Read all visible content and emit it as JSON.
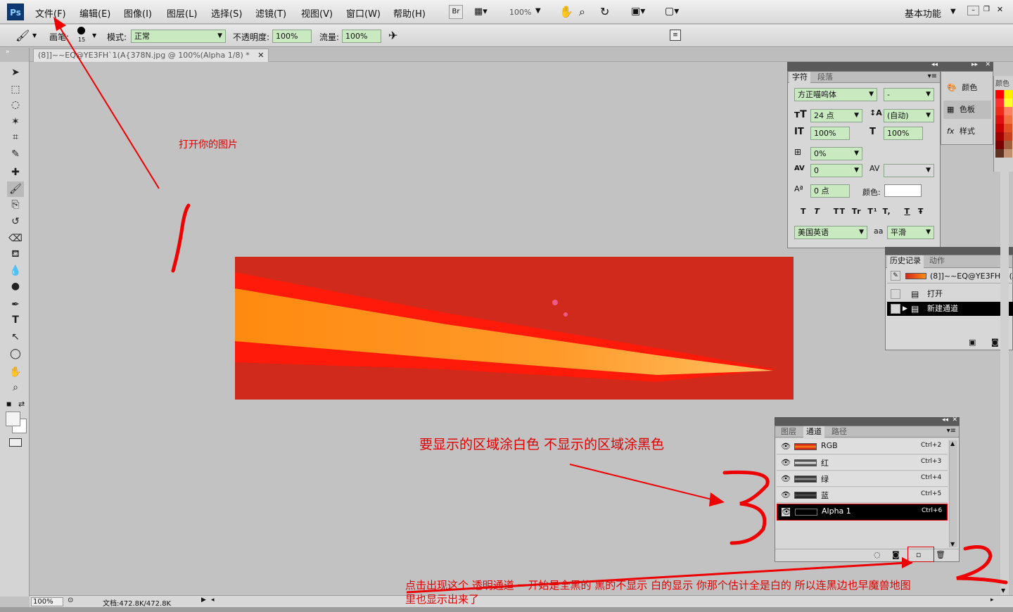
{
  "app": {
    "logo": "Ps",
    "workspace": "基本功能"
  },
  "menu": [
    "文件(F)",
    "编辑(E)",
    "图像(I)",
    "图层(L)",
    "选择(S)",
    "滤镜(T)",
    "视图(V)",
    "窗口(W)",
    "帮助(H)"
  ],
  "appbar": {
    "bridge": "Br",
    "zoom": "100%"
  },
  "options": {
    "brush_label": "画笔:",
    "brush_size": "15",
    "mode_label": "模式:",
    "mode_value": "正常",
    "opacity_label": "不透明度:",
    "opacity_value": "100%",
    "flow_label": "流量:",
    "flow_value": "100%"
  },
  "document": {
    "tab_title": "(8]]~~EQ@YE3FH`1(A{378N.jpg @ 100%(Alpha 1/8) *"
  },
  "status": {
    "zoom": "100%",
    "doc_info": "文档:472.8K/472.8K"
  },
  "char_panel": {
    "tabs": [
      "字符",
      "段落"
    ],
    "font_family": "方正喵呜体",
    "font_style": "-",
    "size": "24 点",
    "leading": "(自动)",
    "v_scale": "100%",
    "h_scale": "100%",
    "tsume": "0%",
    "kerning": "0",
    "baseline": "0 点",
    "color_label": "颜色:",
    "language": "美国英语",
    "aa_label": "aa",
    "antialias": "平滑",
    "style_buttons": [
      "T",
      "T",
      "TT",
      "Tr",
      "T¹",
      "T,",
      "T",
      "Ŧ"
    ]
  },
  "side_panels": {
    "color": "颜色",
    "swatches": "色板",
    "styles": "样式",
    "strip_title": "颜色"
  },
  "history_panel": {
    "tabs": [
      "历史记录",
      "动作"
    ],
    "snapshot": "(8]]~~EQ@YE3FH`1(A.",
    "items": [
      "打开",
      "新建通道"
    ]
  },
  "channels_panel": {
    "tabs": [
      "图层",
      "通道",
      "路径"
    ],
    "rows": [
      {
        "name": "RGB",
        "key": "Ctrl+2"
      },
      {
        "name": "红",
        "key": "Ctrl+3"
      },
      {
        "name": "绿",
        "key": "Ctrl+4"
      },
      {
        "name": "蓝",
        "key": "Ctrl+5"
      },
      {
        "name": "Alpha 1",
        "key": "Ctrl+6"
      }
    ]
  },
  "annotations": {
    "open_image": "打开你的图片",
    "paint_hint": "要显示的区域涂白色 不显示的区域涂黑色",
    "click_hint_1": "点击出现这个 透明通道 一开始是全黑的 黑的不显示 白的显示 你那个估计全是白的 所以连黑边也早魔兽地图",
    "click_hint_2": "里也显示出来了",
    "num1": "1",
    "num2": "2",
    "num3": "3"
  }
}
